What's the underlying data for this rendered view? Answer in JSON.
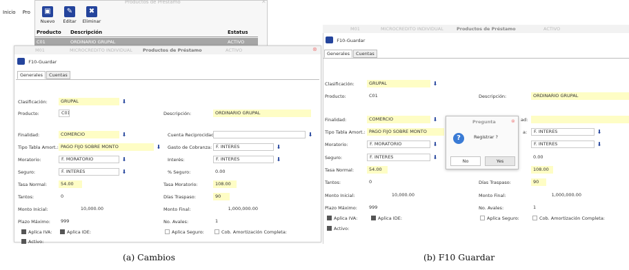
{
  "left": {
    "menubar": [
      "Inicio",
      "Pro"
    ],
    "toolbar_window": {
      "title": "Productos de Préstamo",
      "buttons": [
        {
          "label": "Nuevo",
          "icon": "new-document-icon"
        },
        {
          "label": "Editar",
          "icon": "edit-icon"
        },
        {
          "label": "Eliminar",
          "icon": "delete-icon"
        }
      ],
      "grid_headers": [
        "Producto",
        "Descripción",
        "Estatus"
      ],
      "grid_rows": [
        [
          "C01",
          "ORDINARIO GRUPAL",
          "ACTIVO"
        ],
        [
          "M01",
          "MICROCREDITO INDIVIDUAL",
          "ACTIVO"
        ]
      ]
    },
    "dialog": {
      "window_title": "F10-Guardar",
      "tabs": [
        "Generales",
        "Cuentas"
      ],
      "fields": {
        "clasificacion": {
          "label": "Clasificación:",
          "value": "GRUPAL"
        },
        "producto": {
          "label": "Producto:",
          "value": "C01"
        },
        "descripcion": {
          "label": "Descripción:",
          "value": "ORDINARIO GRUPAL"
        },
        "finalidad": {
          "label": "Finalidad:",
          "value": "COMERCIO"
        },
        "cuenta_reciprocidad": {
          "label": "Cuenta Reciprocidad:",
          "value": ""
        },
        "tipo_tabla": {
          "label": "Tipo Tabla Amort.:",
          "value": "PAGO FIJO SOBRE MONTO"
        },
        "gasto_cobranza": {
          "label": "Gasto de Cobranza:",
          "value": "F. INTERES"
        },
        "moratorio": {
          "label": "Moratorio:",
          "value": "F. MORATORIO"
        },
        "interes": {
          "label": "Interés:",
          "value": "F. INTERES"
        },
        "seguro": {
          "label": "Seguro:",
          "value": "F. INTERES"
        },
        "pct_seguro": {
          "label": "% Seguro:",
          "value": "0.00"
        },
        "tasa_normal": {
          "label": "Tasa Normal:",
          "value": "54.00"
        },
        "tasa_moratorio": {
          "label": "Tasa Moratorio:",
          "value": "108.00"
        },
        "tantos": {
          "label": "Tantos:",
          "value": "0"
        },
        "dias_traspaso": {
          "label": "Días Traspaso:",
          "value": "90"
        },
        "monto_inicial": {
          "label": "Monto Inicial:",
          "value": "10,000.00"
        },
        "monto_final": {
          "label": "Monto Final:",
          "value": "1,000,000.00"
        },
        "plazo_maximo": {
          "label": "Plazo Máximo:",
          "value": "999"
        },
        "no_avales": {
          "label": "No. Avales:",
          "value": "1"
        }
      },
      "checkboxes": {
        "aplica_iva": {
          "label": "Aplica IVA:",
          "checked": true
        },
        "aplica_ide": {
          "label": "Aplica IDE:",
          "checked": true
        },
        "aplica_seguro": {
          "label": "Aplica Seguro:",
          "checked": false
        },
        "cob_amort": {
          "label": "Cob. Amortización Completa:",
          "checked": false
        },
        "activo": {
          "label": "Activo:",
          "checked": true
        }
      }
    },
    "caption": "(a)  Cambios"
  },
  "right": {
    "top_row": {
      "code": "M01",
      "description": "MICROCREDITO INDIVIDUAL",
      "status": "ACTIVO"
    },
    "window_title": "F10-Guardar",
    "tabs": [
      "Generales",
      "Cuentas"
    ],
    "fields": {
      "clasificacion": {
        "label": "Clasificación:",
        "value": "GRUPAL"
      },
      "producto": {
        "label": "Producto:",
        "value": "C01"
      },
      "descripcion": {
        "label": "Descripción:",
        "value": "ORDINARIO GRUPAL"
      },
      "finalidad": {
        "label": "Finalidad:",
        "value": "COMERCIO"
      },
      "cuenta_reciprocidad": {
        "label": "ad:"
      },
      "tipo_tabla": {
        "label": "Tipo Tabla Amort.:",
        "value": "PAGO FIJO SOBRE MONTO"
      },
      "gasto_cobranza": {
        "label": "a:",
        "value": "F. INTERES"
      },
      "moratorio": {
        "label": "Moratorio:",
        "value": "F. MORATORIO"
      },
      "interes": {
        "value": "F. INTERES"
      },
      "seguro": {
        "label": "Seguro:",
        "value": "F. INTERES"
      },
      "pct_seguro": {
        "value": "0.00"
      },
      "tasa_normal": {
        "label": "Tasa Normal:",
        "value": "54.00"
      },
      "tasa_moratorio": {
        "value": "108.00"
      },
      "tantos": {
        "label": "Tantos:",
        "value": "0"
      },
      "dias_traspaso": {
        "label": "Días Traspaso:",
        "value": "90"
      },
      "monto_inicial": {
        "label": "Monto Inicial:",
        "value": "10,000.00"
      },
      "monto_final": {
        "label": "Monto Final:",
        "value": "1,000,000.00"
      },
      "plazo_maximo": {
        "label": "Plazo Máximo:",
        "value": "999"
      },
      "no_avales": {
        "label": "No. Avales:",
        "value": "1"
      }
    },
    "checkboxes": {
      "aplica_iva": {
        "label": "Aplica IVA:",
        "checked": true
      },
      "aplica_ide": {
        "label": "Aplica IDE:",
        "checked": true
      },
      "aplica_seguro": {
        "label": "Aplica Seguro:",
        "checked": false
      },
      "cob_amort": {
        "label": "Cob. Amortización Completa:",
        "checked": false
      },
      "activo": {
        "label": "Activo:",
        "checked": true
      }
    },
    "confirm_dialog": {
      "title": "Pregunta",
      "message": "Registrar ?",
      "no_label": "No",
      "yes_label": "Yes"
    },
    "caption": "(b)  F10 Guardar"
  },
  "colors": {
    "accent": "#24449c",
    "field_highlight": "#fefdc5",
    "grid_selected": "#a6a6a6"
  }
}
